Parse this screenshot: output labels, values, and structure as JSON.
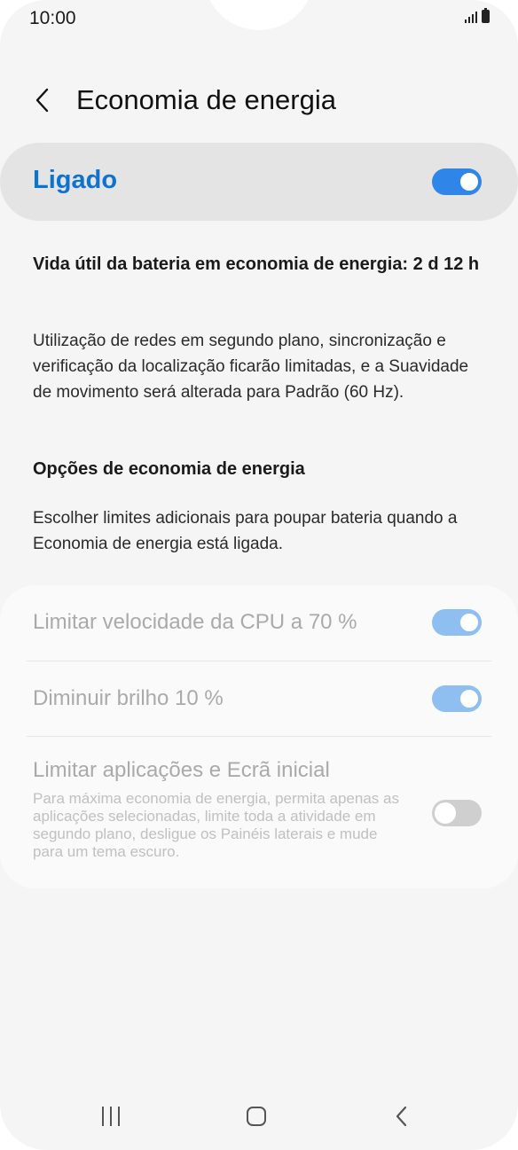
{
  "status_bar": {
    "time": "10:00",
    "icons": [
      "signal-icon",
      "battery-icon"
    ]
  },
  "header": {
    "back_icon": "chevron-left-icon",
    "title": "Economia de energia"
  },
  "master_switch": {
    "label": "Ligado",
    "state": "on"
  },
  "battery_life": {
    "text": "Vida útil da bateria em economia de energia: 2 d 12 h"
  },
  "description": {
    "text": "Utilização de redes em segundo plano, sincronização e verificação da localização ficarão limitadas, e a Suavidade de movimento será alterada para Padrão (60 Hz)."
  },
  "options_section": {
    "heading": "Opções de economia de energia",
    "subtext": "Escolher limites adicionais para poupar bateria quando a Economia de energia está ligada."
  },
  "options": [
    {
      "title": "Limitar velocidade da CPU a 70 %",
      "state": "on"
    },
    {
      "title": "Diminuir brilho 10 %",
      "state": "on"
    },
    {
      "title": "Limitar aplicações e Ecrã inicial",
      "description": "Para máxima economia de energia, permita apenas as aplicações selecionadas, limite toda a atividade em segundo plano, desligue os Painéis laterais e mude para um tema escuro.",
      "state": "off"
    }
  ],
  "navigation_bar": {
    "recent_icon": "recent-apps-icon",
    "home_icon": "home-icon",
    "back_icon": "back-icon"
  },
  "colors": {
    "accent": "#2f86e8",
    "title_accent": "#0d72d0",
    "background": "#f5f5f5"
  }
}
